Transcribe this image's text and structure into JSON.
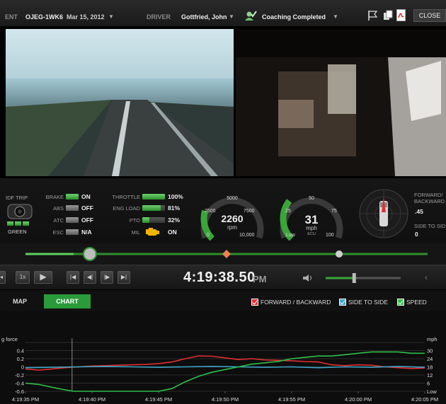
{
  "header": {
    "event_label": "ENT",
    "event_id": "OJEG-1WK6",
    "event_date": "Mar 15, 2012",
    "driver_label": "DRIVER",
    "driver_name": "Gottfried, John",
    "status": "Coaching Completed",
    "close_label": "CLOSE"
  },
  "dash": {
    "idf_trip_label": "IDF TRIP",
    "camera_status": "GREEN",
    "indicators": [
      {
        "label": "BRAKE",
        "value": "ON",
        "state": "on"
      },
      {
        "label": "ABS",
        "value": "OFF",
        "state": "off"
      },
      {
        "label": "ATC",
        "value": "OFF",
        "state": "off"
      },
      {
        "label": "ESC",
        "value": "N/A",
        "state": "off"
      }
    ],
    "engine": [
      {
        "label": "THROTTLE",
        "value": "100%",
        "fill": 1.0
      },
      {
        "label": "ENG LOAD",
        "value": "81%",
        "fill": 0.81
      },
      {
        "label": "PTO",
        "value": "32%",
        "fill": 0.32
      }
    ],
    "mil_label": "MIL",
    "mil_value": "ON",
    "rpm_gauge": {
      "value": "2260",
      "unit": "rpm",
      "ticks": [
        "0",
        "2500",
        "5000",
        "7500",
        "10,000"
      ],
      "level": 0.226
    },
    "speed_gauge": {
      "value": "31",
      "unit": "mph",
      "sub": "ECU",
      "ticks": [
        "Low",
        "25",
        "50",
        "75",
        "100"
      ],
      "level": 0.31
    },
    "force": {
      "fb_label": "FORWARD/ BACKWARD",
      "fb_value": ".45",
      "ss_label": "SIDE TO SIDE",
      "ss_value": "0"
    }
  },
  "timeline": {
    "position": 0.16,
    "marker": 0.5,
    "end": 0.78
  },
  "transport": {
    "speed": "1x",
    "time": "4:19:38.50",
    "ampm": "PM",
    "volume": 0.38
  },
  "tabs": {
    "map": "MAP",
    "chart": "CHART",
    "active": "chart"
  },
  "legend": {
    "forward_backward": "FORWARD / BACKWARD",
    "side_to_side": "SIDE TO SIDE",
    "speed": "SPEED"
  },
  "colors": {
    "forward_backward": "#e03030",
    "side_to_side": "#3fa6c8",
    "speed": "#2fbf4a",
    "accent_green": "#3aa63a"
  },
  "chart_data": {
    "type": "line",
    "left_axis_label": "g force",
    "right_axis_label": "mph",
    "ylim": [
      -0.6,
      0.6
    ],
    "y2lim": [
      0,
      36
    ],
    "left_ticks": [
      "0.6",
      "0.4",
      "0.2",
      "0",
      "-0.2",
      "-0.4",
      "-0.6"
    ],
    "right_ticks": [
      "",
      "30",
      "24",
      "18",
      "12",
      "6",
      "Low"
    ],
    "x_labels": [
      "4:19:35 PM",
      "4:19:40 PM",
      "4:19:45 PM",
      "4:19:50 PM",
      "4:19:55 PM",
      "4:20:00 PM",
      "4:20:05 PM"
    ],
    "cursor_time_sec": 3.5,
    "x_range_sec": [
      0,
      30
    ],
    "series": [
      {
        "name": "FORWARD / BACKWARD",
        "axis": "left",
        "x": [
          0,
          1,
          2,
          3,
          4,
          5,
          6,
          7,
          8,
          9,
          10,
          11,
          12,
          13,
          14,
          15,
          16,
          17,
          18,
          19,
          20,
          21,
          22,
          23,
          24,
          25,
          26,
          27,
          28,
          29,
          30
        ],
        "y": [
          -0.05,
          -0.08,
          -0.05,
          -0.02,
          0.0,
          0.02,
          0.03,
          0.04,
          0.05,
          0.06,
          0.08,
          0.12,
          0.2,
          0.27,
          0.26,
          0.22,
          0.18,
          0.2,
          0.17,
          0.16,
          0.15,
          0.13,
          0.12,
          0.05,
          0.03,
          0.05,
          0.04,
          0.0,
          -0.02,
          -0.04,
          -0.03
        ]
      },
      {
        "name": "SIDE TO SIDE",
        "axis": "left",
        "x": [
          0,
          2,
          4,
          6,
          8,
          10,
          12,
          14,
          16,
          18,
          20,
          22,
          24,
          26,
          28,
          30
        ],
        "y": [
          -0.02,
          -0.01,
          0.0,
          0.01,
          0.0,
          -0.01,
          0.0,
          0.01,
          0.0,
          -0.01,
          0.0,
          -0.02,
          0.0,
          -0.01,
          0.01,
          -0.01
        ]
      },
      {
        "name": "SPEED",
        "axis": "right",
        "x": [
          0,
          1,
          2,
          3,
          3.6,
          4,
          5,
          6,
          7,
          8,
          9,
          10,
          11,
          12,
          13,
          14,
          15,
          16,
          17,
          18,
          19,
          20,
          21,
          22,
          23,
          24,
          25,
          26,
          27,
          28,
          29,
          30
        ],
        "y": [
          6,
          5,
          3,
          1,
          0,
          0,
          0,
          0,
          0,
          0,
          0,
          0,
          2,
          7,
          11,
          14,
          16,
          18,
          20,
          21,
          22,
          24,
          25,
          26,
          26,
          27,
          28,
          29,
          29,
          29,
          28,
          28
        ]
      }
    ]
  }
}
